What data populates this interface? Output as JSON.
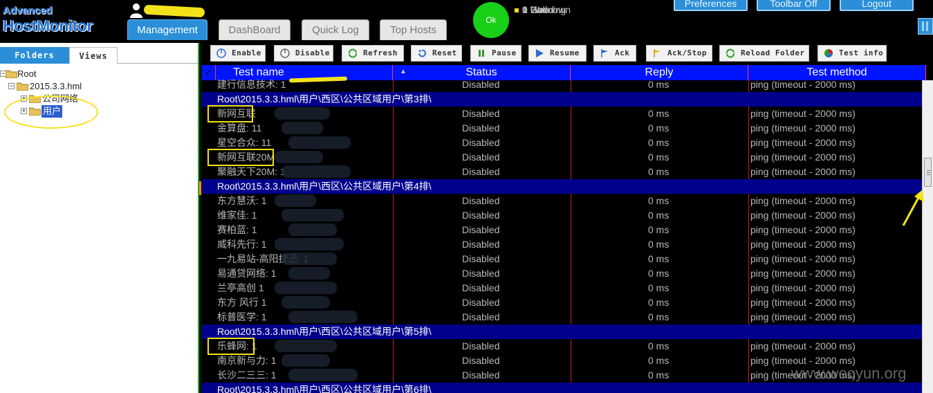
{
  "app": {
    "logo_line1": "Advanced",
    "logo_line2": "HostMonitor"
  },
  "tabs": [
    {
      "label": "Management",
      "active": true
    },
    {
      "label": "DashBoard"
    },
    {
      "label": "Quick Log"
    },
    {
      "label": "Top Hosts"
    }
  ],
  "status": {
    "circle_label": "Ok",
    "legend": [
      {
        "count": "1",
        "label": "Good",
        "color": "#1fd81f"
      },
      {
        "count": "0",
        "label": "Bad",
        "color": "#e01010"
      },
      {
        "count": "0",
        "label": "Warning",
        "color": "#f08080"
      },
      {
        "count": "0",
        "label": "Unknown",
        "color": "#f0e020"
      }
    ]
  },
  "top_buttons": {
    "preferences": "Preferences",
    "toolbar_off": "Toolbar Off",
    "logout": "Logout"
  },
  "left_tabs": {
    "folders": "Folders",
    "views": "Views"
  },
  "tree": {
    "root": "Root",
    "file": "2015.3.3.hml",
    "company_network": "公司网络",
    "users": "用户"
  },
  "toolbar": [
    {
      "label": "Enable",
      "icon": "power-icon"
    },
    {
      "label": "Disable",
      "icon": "power-icon"
    },
    {
      "label": "Refresh",
      "icon": "refresh-icon"
    },
    {
      "label": "Reset",
      "icon": "reset-icon"
    },
    {
      "label": "Pause",
      "icon": "pause-icon"
    },
    {
      "label": "Resume",
      "icon": "play-icon"
    },
    {
      "label": "Ack",
      "icon": "flag-icon"
    },
    {
      "label": "Ack/Stop",
      "icon": "flag-icon"
    },
    {
      "label": "Reload Folder",
      "icon": "reload-icon"
    },
    {
      "label": "Test info",
      "icon": "pie-icon"
    }
  ],
  "grid": {
    "columns": {
      "check": "✓",
      "name": "Test name",
      "status": "Status",
      "reply": "Reply",
      "method": "Test method"
    },
    "partial_top": {
      "name": "建行信息技术: 1",
      "status": "Disabled",
      "reply": "0 ms",
      "method": "ping (timeout - 2000 ms)"
    },
    "groups": [
      {
        "path": "Root\\2015.3.3.hml\\用户\\西区\\公共区域用户\\第3排\\",
        "rows": [
          {
            "name": "新网互联",
            "status": "Disabled",
            "reply": "0 ms",
            "method": "ping (timeout - 2000 ms)"
          },
          {
            "name": "金算盘: 11",
            "status": "Disabled",
            "reply": "0 ms",
            "method": "ping (timeout - 2000 ms)"
          },
          {
            "name": "星空合众: 11",
            "status": "Disabled",
            "reply": "0 ms",
            "method": "ping (timeout - 2000 ms)"
          },
          {
            "name": "新网互联20M",
            "status": "Disabled",
            "reply": "0 ms",
            "method": "ping (timeout - 2000 ms)"
          },
          {
            "name": "聚融天下20M: 1",
            "status": "Disabled",
            "reply": "0 ms",
            "method": "ping (timeout - 2000 ms)"
          }
        ]
      },
      {
        "path": "Root\\2015.3.3.hml\\用户\\西区\\公共区域用户\\第4排\\",
        "rows": [
          {
            "name": "东方慧沃: 1",
            "status": "Disabled",
            "reply": "0 ms",
            "method": "ping (timeout - 2000 ms)"
          },
          {
            "name": "维家佳: 1",
            "status": "Disabled",
            "reply": "0 ms",
            "method": "ping (timeout - 2000 ms)"
          },
          {
            "name": "赛柏蓝: 1",
            "status": "Disabled",
            "reply": "0 ms",
            "method": "ping (timeout - 2000 ms)"
          },
          {
            "name": "威科先行: 1",
            "status": "Disabled",
            "reply": "0 ms",
            "method": "ping (timeout - 2000 ms)"
          },
          {
            "name": "一九易站-高阳捷迅: 1",
            "status": "Disabled",
            "reply": "0 ms",
            "method": "ping (timeout - 2000 ms)"
          },
          {
            "name": "易通贷网络: 1",
            "status": "Disabled",
            "reply": "0 ms",
            "method": "ping (timeout - 2000 ms)"
          },
          {
            "name": "兰亭高创 1",
            "status": "Disabled",
            "reply": "0 ms",
            "method": "ping (timeout - 2000 ms)"
          },
          {
            "name": "东方 风行 1",
            "status": "Disabled",
            "reply": "0 ms",
            "method": "ping (timeout - 2000 ms)"
          },
          {
            "name": "标普医学: 1",
            "status": "Disabled",
            "reply": "0 ms",
            "method": "ping (timeout - 2000 ms)"
          }
        ]
      },
      {
        "path": "Root\\2015.3.3.hml\\用户\\西区\\公共区域用户\\第5排\\",
        "rows": [
          {
            "name": "乐蜂网: 1",
            "status": "Disabled",
            "reply": "0 ms",
            "method": "ping (timeout - 2000 ms)"
          },
          {
            "name": "南京新与力: 1",
            "status": "Disabled",
            "reply": "0 ms",
            "method": "ping (timeout - 2000 ms)"
          },
          {
            "name": "长沙二三三: 1",
            "status": "Disabled",
            "reply": "0 ms",
            "method": "ping (timeout - 2000 ms)"
          }
        ]
      },
      {
        "path": "Root\\2015.3.3.hml\\用户\\西区\\公共区域用户\\第6排\\",
        "rows": []
      }
    ]
  },
  "watermark": "www.wooyun.org"
}
